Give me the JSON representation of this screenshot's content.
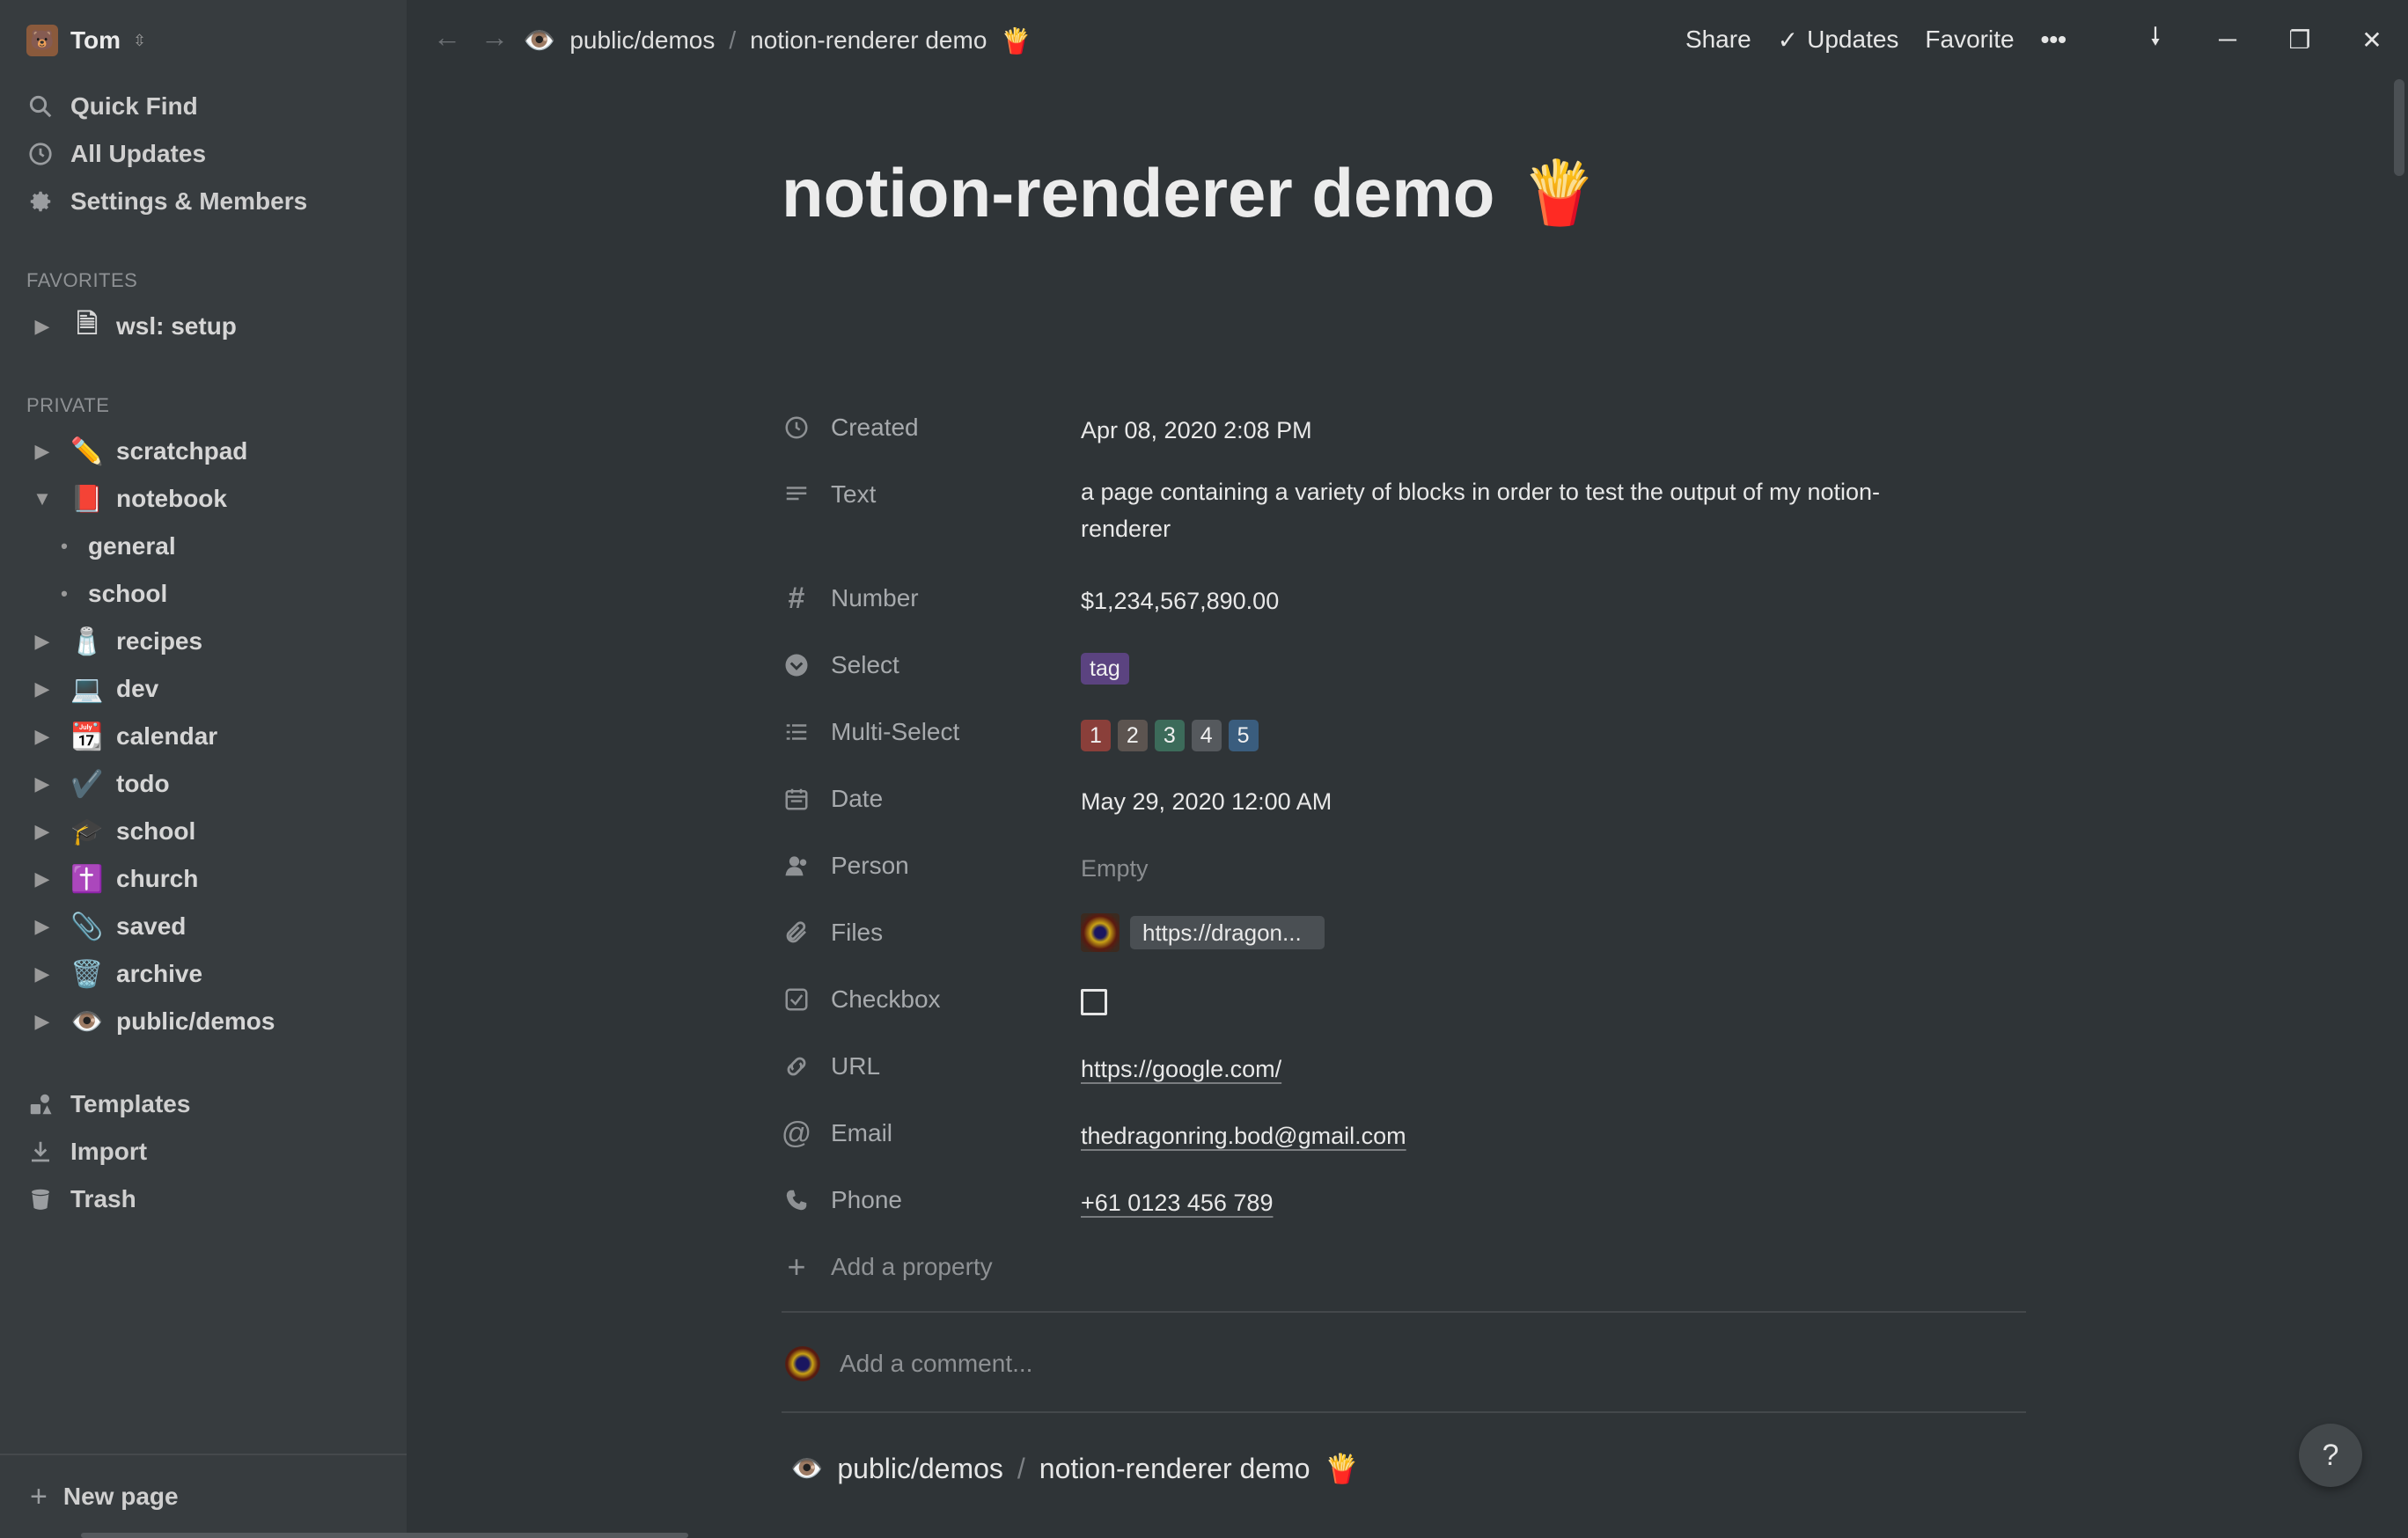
{
  "workspace": {
    "name": "Tom",
    "avatar_emoji": "🐻",
    "switch_icon": "⇳"
  },
  "sidebar": {
    "nav": [
      {
        "label": "Quick Find",
        "icon": "search-icon"
      },
      {
        "label": "All Updates",
        "icon": "clock-icon"
      },
      {
        "label": "Settings & Members",
        "icon": "gear-icon"
      }
    ],
    "favorites_label": "FAVORITES",
    "favorites": [
      {
        "label": "wsl: setup",
        "emoji": "🗎"
      }
    ],
    "private_label": "PRIVATE",
    "private": [
      {
        "label": "scratchpad",
        "emoji": "✏️",
        "expanded": false
      },
      {
        "label": "notebook",
        "emoji": "📕",
        "expanded": true
      },
      {
        "label": "general",
        "sub": true
      },
      {
        "label": "school",
        "sub": true
      },
      {
        "label": "recipes",
        "emoji": "🧂",
        "expanded": false
      },
      {
        "label": "dev",
        "emoji": "💻",
        "expanded": false
      },
      {
        "label": "calendar",
        "emoji": "📆",
        "expanded": false
      },
      {
        "label": "todo",
        "emoji": "✔️",
        "expanded": false
      },
      {
        "label": "school",
        "emoji": "🎓",
        "expanded": false
      },
      {
        "label": "church",
        "emoji": "✝️",
        "expanded": false
      },
      {
        "label": "saved",
        "emoji": "📎",
        "expanded": false
      },
      {
        "label": "archive",
        "emoji": "🗑️",
        "expanded": false
      },
      {
        "label": "public/demos",
        "emoji": "👁️",
        "expanded": false
      }
    ],
    "bottom": [
      {
        "label": "Templates",
        "icon": "templates-icon"
      },
      {
        "label": "Import",
        "icon": "import-icon"
      },
      {
        "label": "Trash",
        "icon": "trash-icon"
      }
    ],
    "new_page": "New page"
  },
  "topbar": {
    "breadcrumb": [
      {
        "label": "public/demos",
        "emoji": "👁️"
      },
      {
        "label": "notion-renderer demo",
        "emoji": "🍟"
      }
    ],
    "breadcrumb_sep": "/",
    "share": "Share",
    "updates": "Updates",
    "favorite": "Favorite",
    "more": "•••"
  },
  "page": {
    "title": "notion-renderer demo",
    "title_emoji": "🍟",
    "properties": [
      {
        "label": "Created",
        "icon": "clock-icon",
        "value": "Apr 08, 2020 2:08 PM"
      },
      {
        "label": "Text",
        "icon": "text-icon",
        "value": "a page containing a variety of blocks in order to test the output of my notion-renderer"
      },
      {
        "label": "Number",
        "icon": "hash-icon",
        "value": "$1,234,567,890.00"
      },
      {
        "label": "Select",
        "icon": "select-icon",
        "tags": [
          {
            "text": "tag",
            "color": "#5b4380"
          }
        ]
      },
      {
        "label": "Multi-Select",
        "icon": "list-icon",
        "tags": [
          {
            "text": "1",
            "color": "#8a3f3a"
          },
          {
            "text": "2",
            "color": "#5c5450"
          },
          {
            "text": "3",
            "color": "#3c6b5a"
          },
          {
            "text": "4",
            "color": "#55595d"
          },
          {
            "text": "5",
            "color": "#3a5d7e"
          }
        ]
      },
      {
        "label": "Date",
        "icon": "calendar-icon",
        "value": "May 29, 2020 12:00 AM"
      },
      {
        "label": "Person",
        "icon": "person-icon",
        "value": "Empty"
      },
      {
        "label": "Files",
        "icon": "paperclip-icon",
        "file": "https://dragon..."
      },
      {
        "label": "Checkbox",
        "icon": "checkbox-icon",
        "checked": false
      },
      {
        "label": "URL",
        "icon": "link-icon",
        "value": "https://google.com/"
      },
      {
        "label": "Email",
        "icon": "at-icon",
        "value": "thedragonring.bod@gmail.com"
      },
      {
        "label": "Phone",
        "icon": "phone-icon",
        "value": "+61 0123 456 789"
      }
    ],
    "add_property": "Add a property",
    "add_comment": "Add a comment...",
    "inline_breadcrumb": [
      {
        "label": "public/demos",
        "emoji": "👁️"
      },
      {
        "label": "notion-renderer demo",
        "emoji": "🍟"
      }
    ],
    "help": "?"
  },
  "colors": {
    "bg": "#2f3437",
    "sidebar": "#373c3f"
  }
}
